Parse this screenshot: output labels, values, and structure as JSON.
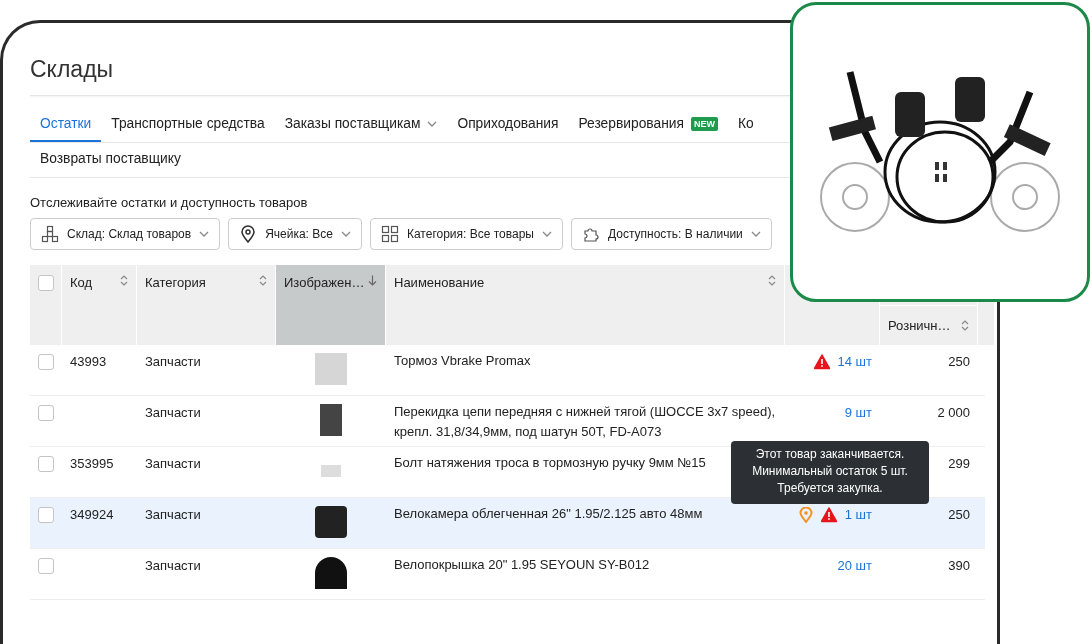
{
  "page": {
    "title": "Склады",
    "description": "Отслеживайте остатки и доступность товаров"
  },
  "tab_rows": [
    [
      {
        "label": "Остатки",
        "selected": true,
        "dropdown": false
      },
      {
        "label": "Транспортные средства",
        "selected": false,
        "dropdown": false
      },
      {
        "label": "Заказы поставщикам",
        "selected": false,
        "dropdown": true
      },
      {
        "label": "Оприходования",
        "selected": false,
        "dropdown": false
      },
      {
        "label": "Резервирования",
        "selected": false,
        "dropdown": false,
        "badge": "NEW"
      },
      {
        "label": "Ко",
        "selected": false,
        "dropdown": false
      }
    ],
    [
      {
        "label": "Возвраты поставщику",
        "selected": false,
        "dropdown": false
      }
    ]
  ],
  "filters": [
    {
      "kind": "warehouse",
      "label": "Склад: Склад товаров"
    },
    {
      "kind": "pin",
      "label": "Ячейка: Все"
    },
    {
      "kind": "grid",
      "label": "Категория: Все товары"
    },
    {
      "kind": "puzzle",
      "label": "Доступность: В наличии"
    }
  ],
  "table": {
    "select_all": {
      "checked": false
    },
    "columns": [
      {
        "label": "Код",
        "kind": "sortable",
        "sorted": false
      },
      {
        "label": "Категория",
        "kind": "sortable",
        "sorted": false
      },
      {
        "label": "Изображен…",
        "kind": "descending",
        "sorted": true
      },
      {
        "label": "Наименование",
        "kind": "sortable",
        "sorted": false
      },
      {
        "label": "Розничн…",
        "kind": "sortable",
        "sorted": false
      }
    ],
    "rows": [
      {
        "checked": false,
        "highlighted": false,
        "code": "43993",
        "category": "Запчасти",
        "name": "Тормоз Vbrake Promax",
        "markers": [
          {
            "kind": "alert"
          }
        ],
        "stock": "14 шт",
        "price": "250"
      },
      {
        "checked": false,
        "highlighted": false,
        "code": "",
        "category": "Запчасти",
        "name": "Перекидка цепи передняя с нижней тягой (ШОССЕ 3х7 speed), крепл. 31,8/34,9мм, под шатун 50Т, FD-A073",
        "markers": [],
        "stock": "9 шт",
        "price": "2 000"
      },
      {
        "checked": false,
        "highlighted": false,
        "code": "353995",
        "category": "Запчасти",
        "name": "Болт натяжения троса в тормозную ручку 9мм №15",
        "markers": [],
        "stock": "",
        "price": "299"
      },
      {
        "checked": false,
        "highlighted": true,
        "code": "349924",
        "category": "Запчасти",
        "name": "Велокамера облегченная 26\" 1.95/2.125 авто 48мм",
        "markers": [
          {
            "kind": "pin"
          },
          {
            "kind": "alert"
          }
        ],
        "stock": "1 шт",
        "price": "250"
      },
      {
        "checked": false,
        "highlighted": false,
        "code": "",
        "category": "Запчасти",
        "name": "Велопокрышка 20\" 1.95 SEYOUN SY-B012",
        "markers": [],
        "stock": "20 шт",
        "price": "390"
      }
    ]
  },
  "tooltip": {
    "lines": [
      "Этот товар заканчивается.",
      "Минимальный остаток 5 шт.",
      "Требуется закупка."
    ]
  }
}
